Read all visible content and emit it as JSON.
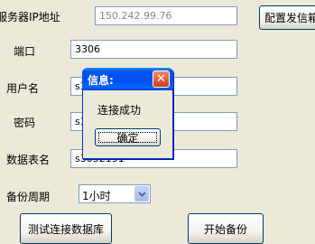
{
  "form": {
    "server_ip_label": "服务器IP地址",
    "server_ip_value": "150.242.99.76",
    "port_label": "端口",
    "port_value": "3306",
    "username_label": "用户名",
    "username_value": "s3",
    "password_label": "密码",
    "password_value": "s3",
    "table_label": "数据表名",
    "table_value": "s3052191",
    "period_label": "备份周期",
    "period_value": "1小时"
  },
  "buttons": {
    "config_sender": "配置发信箱",
    "test_connection": "测试连接数据库",
    "start_backup": "开始备份"
  },
  "dialog": {
    "title": "信息:",
    "close": "✕",
    "message": "连接成功",
    "ok": "确定"
  }
}
